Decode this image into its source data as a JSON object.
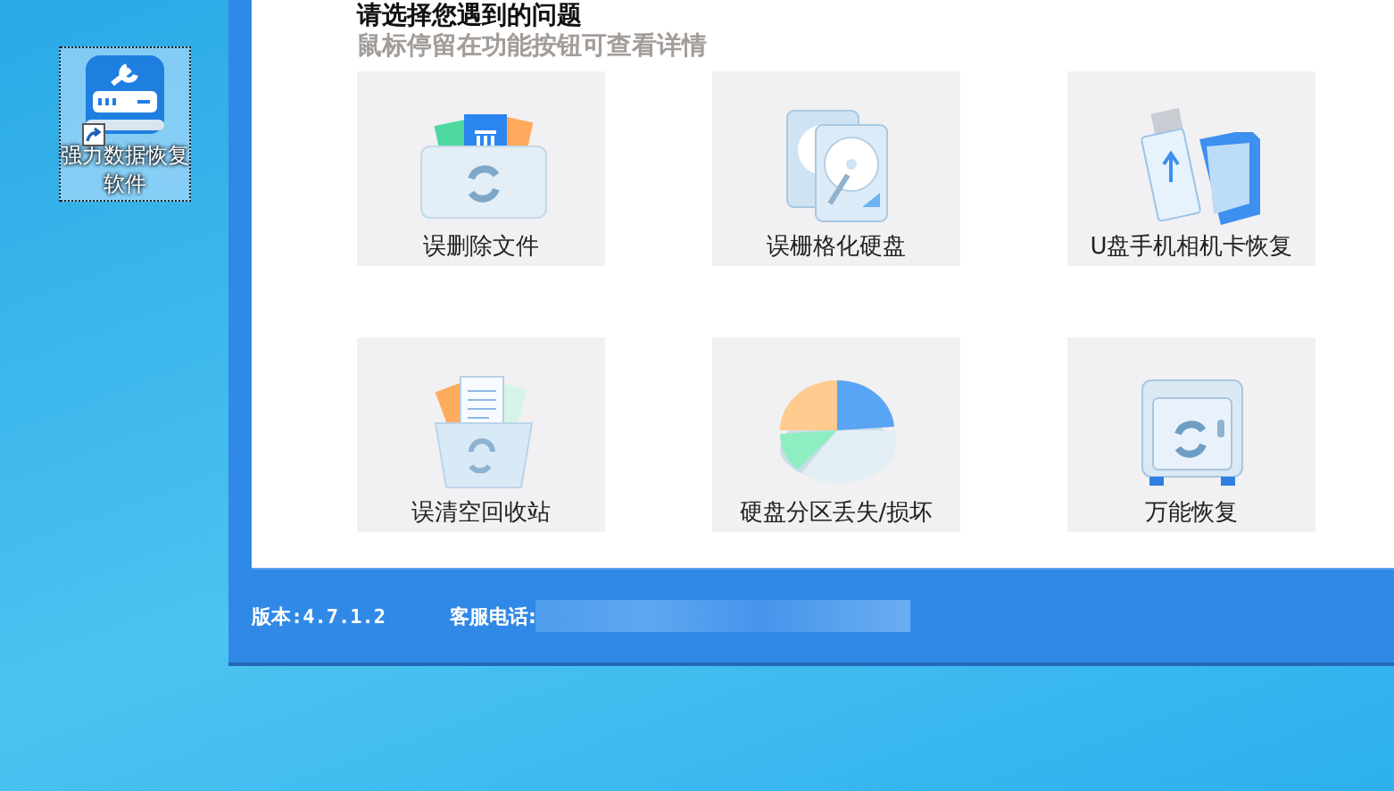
{
  "desktop_icon": {
    "label": "强力数据恢复软件",
    "selected": true
  },
  "window": {
    "heading": "请选择您遇到的问题",
    "hint": "鼠标停留在功能按钮可查看详情",
    "options": [
      {
        "kind": "files",
        "label": "误删除文件"
      },
      {
        "kind": "disk",
        "label": "误栅格化硬盘"
      },
      {
        "kind": "usb",
        "label": "U盘手机相机卡恢复"
      },
      {
        "kind": "recycle",
        "label": "误清空回收站"
      },
      {
        "kind": "partition",
        "label": "硬盘分区丢失/损坏"
      },
      {
        "kind": "safe",
        "label": "万能恢复"
      }
    ],
    "status_bar": {
      "version": "版本:4.7.1.2",
      "phone_label": "客服电话:"
    }
  }
}
